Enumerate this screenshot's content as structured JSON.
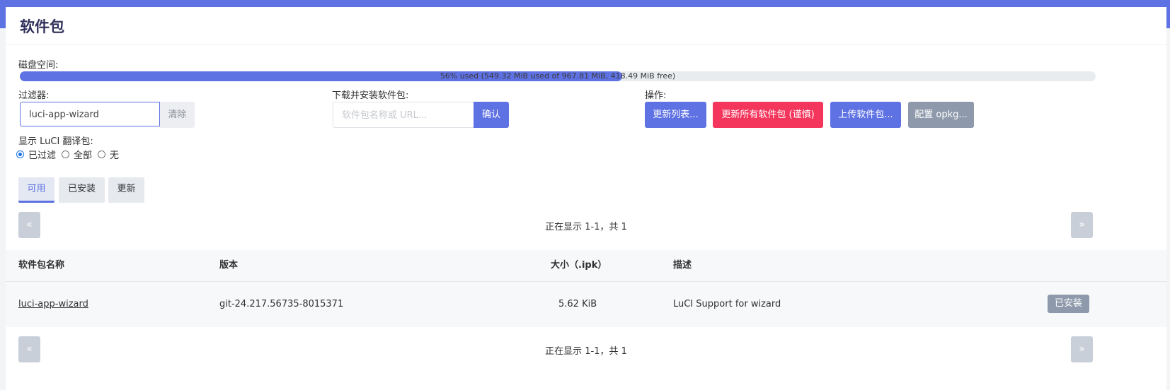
{
  "page": {
    "title": "软件包",
    "accent": "#5f72e4"
  },
  "disk": {
    "label": "磁盘空间:",
    "percent": 56,
    "text": "56% used (549.32 MiB used of 967.81 MiB, 418.49 MiB free)"
  },
  "filter": {
    "label": "过滤器:",
    "value": "luci-app-wizard",
    "clear_label": "清除"
  },
  "download": {
    "label": "下载并安装软件包:",
    "placeholder": "软件包名称或 URL...",
    "confirm_label": "确认"
  },
  "actions": {
    "label": "操作:",
    "update_lists": "更新列表...",
    "upgrade_all": "更新所有软件包 (谨慎)",
    "upload": "上传软件包...",
    "configure": "配置 opkg..."
  },
  "translations": {
    "label": "显示 LuCI 翻译包:",
    "options": [
      "已过滤",
      "全部",
      "无"
    ],
    "selected": "已过滤"
  },
  "tabs": [
    "可用",
    "已安装",
    "更新"
  ],
  "pager": {
    "prev": "«",
    "next": "»",
    "text": "正在显示 1-1，共 1"
  },
  "table": {
    "headers": [
      "软件包名称",
      "版本",
      "大小（.ipk）",
      "描述"
    ],
    "rows": [
      {
        "name": "luci-app-wizard",
        "version": "git-24.217.56735-8015371",
        "size": "5.62 KiB",
        "description": "LuCI Support for wizard",
        "action": "已安装"
      }
    ]
  },
  "colors": {
    "primary": "#5f72e4",
    "danger": "#f5365c",
    "secondary": "#8e9aab"
  }
}
